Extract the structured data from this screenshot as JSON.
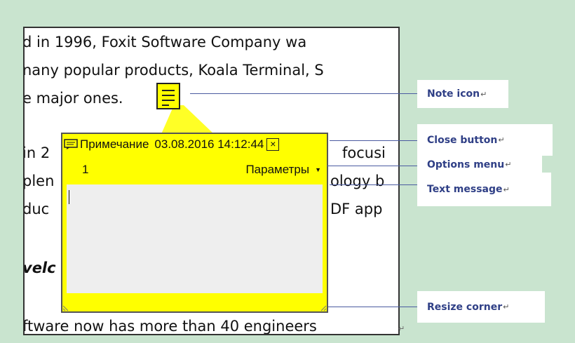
{
  "document": {
    "lines": [
      "d in 1996, Foxit Software Company wa",
      "nany popular products, Koala Terminal, S",
      "e major ones.",
      "in 2",
      "focusi",
      "plen",
      "ology b",
      "duc",
      "DF app",
      "velc",
      "ftware now has more than 40 engineers"
    ],
    "return_mark": "↵"
  },
  "note_popup": {
    "title": "Примечание",
    "datetime": "03.08.2016 14:12:44",
    "close_glyph": "×",
    "page_number": "1",
    "options_label": "Параметры",
    "options_arrow": "▼",
    "note_text": ""
  },
  "callouts": {
    "note_icon": "Note icon",
    "close_button": "Close button",
    "options_menu": "Options menu",
    "text_message": "Text message",
    "resize_corner": "Resize corner",
    "return_mark": "↵"
  },
  "colors": {
    "background": "#c9e4cf",
    "note_yellow": "#ffff00",
    "callout_text": "#2f3f86"
  }
}
